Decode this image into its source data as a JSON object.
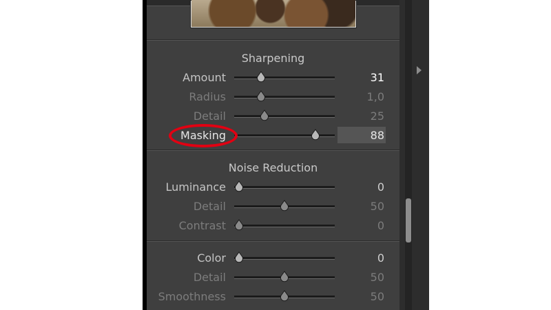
{
  "sharpening": {
    "title": "Sharpening",
    "rows": [
      {
        "label": "Amount",
        "value": "31",
        "level": 0.24
      },
      {
        "label": "Radius",
        "value": "1,0",
        "level": 0.24
      },
      {
        "label": "Detail",
        "value": "25",
        "level": 0.28
      },
      {
        "label": "Masking",
        "value": "88",
        "level": 0.84
      }
    ]
  },
  "noise": {
    "title": "Noise Reduction",
    "rows": [
      {
        "label": "Luminance",
        "value": "0",
        "level": 0.0
      },
      {
        "label": "Detail",
        "value": "50",
        "level": 0.5
      },
      {
        "label": "Contrast",
        "value": "0",
        "level": 0.0
      }
    ],
    "color_rows": [
      {
        "label": "Color",
        "value": "0",
        "level": 0.0
      },
      {
        "label": "Detail",
        "value": "50",
        "level": 0.5
      },
      {
        "label": "Smoothness",
        "value": "50",
        "level": 0.5
      }
    ]
  },
  "colors": {
    "highlight_ring": "#e10012",
    "panel_bg": "#3f3f3f"
  }
}
